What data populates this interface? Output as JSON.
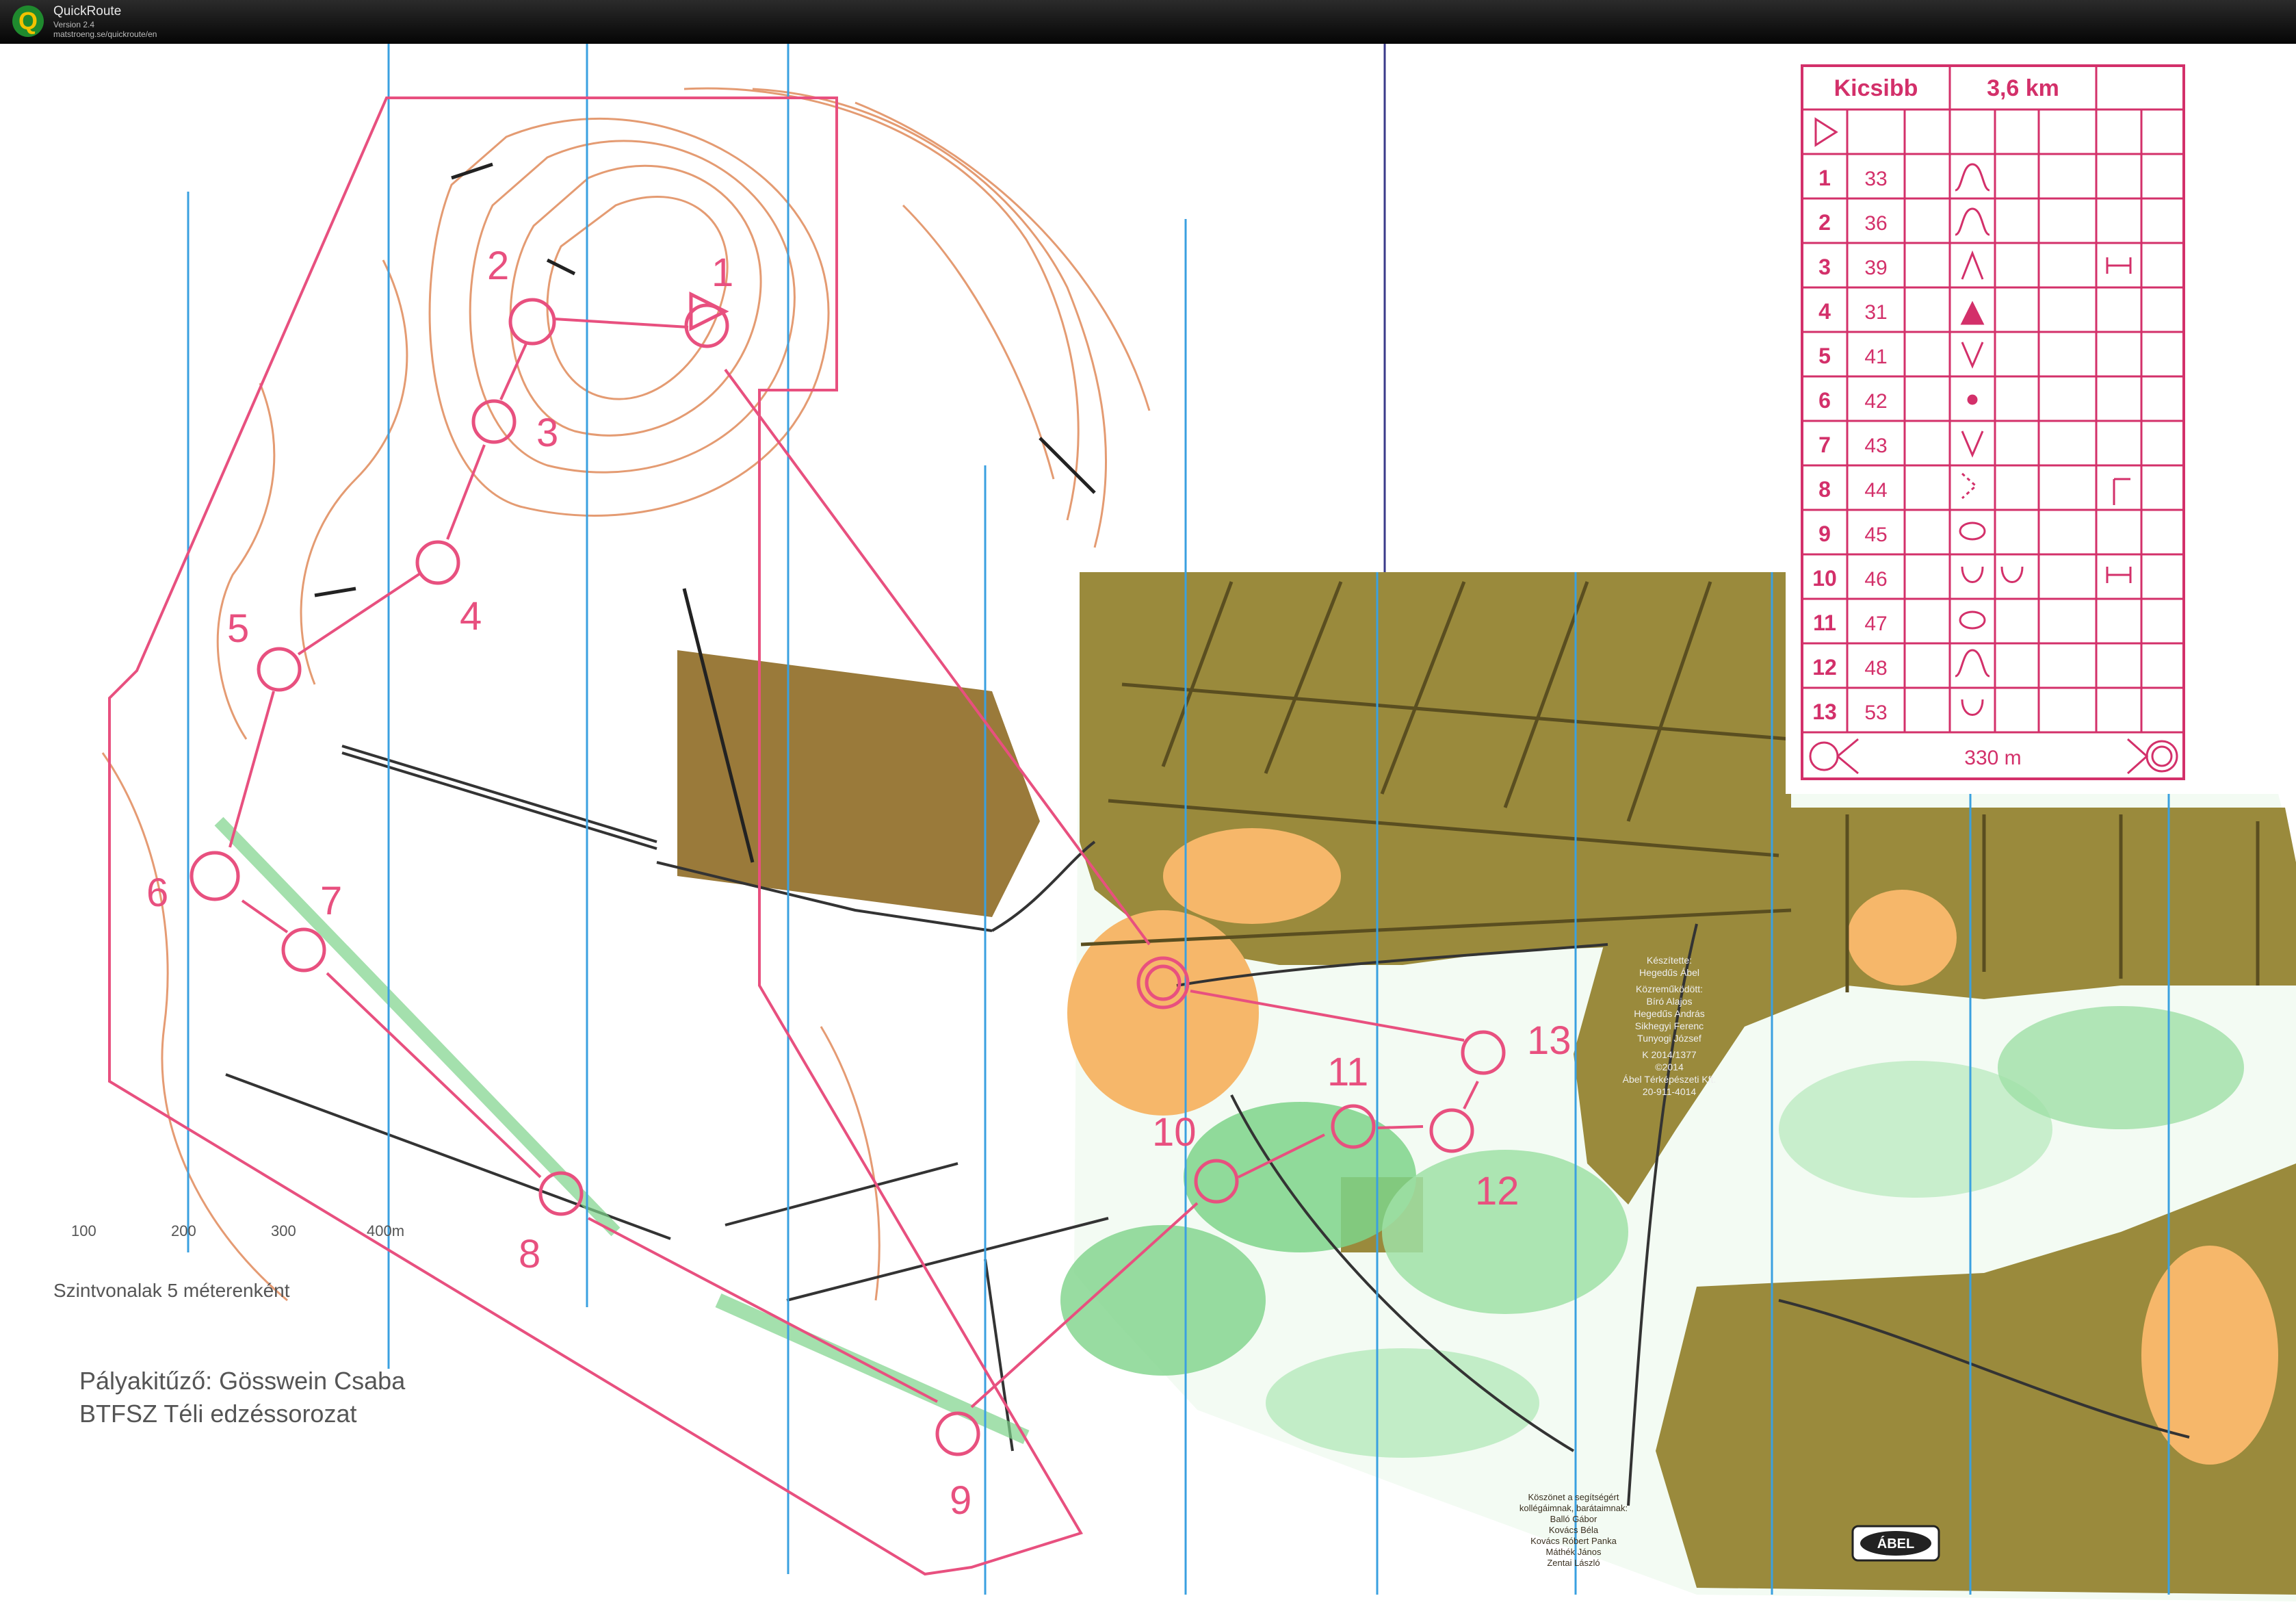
{
  "app": {
    "name": "QuickRoute",
    "version": "Version 2.4",
    "url": "matstroeng.se/quickroute/en",
    "logo_letter": "Q"
  },
  "map": {
    "scale_ticks": [
      "100",
      "200",
      "300",
      "400m"
    ],
    "contour_note": "Szintvonalak 5 méterenként",
    "course_setter": "Pályakitűző: Gösswein Csaba",
    "series_name": "BTFSZ Téli edzéssorozat",
    "credits_top": [
      "Készítette:",
      "Hegedűs Ábel",
      "Közreműködött:",
      "Bíró Alajos",
      "Hegedűs András",
      "Sikhegyi Ferenc",
      "Tunyogi József",
      "K 2014/1377",
      "©2014",
      "Ábel Térképészeti Kft.",
      "20-911-4014"
    ],
    "credits_bottom": [
      "Köszönet a segítségért",
      "kollégáimnak, barátaimnak:",
      "Balló Gábor",
      "Kovács Béla",
      "Kovács Róbert Panka",
      "Máthék János",
      "Zentai László"
    ],
    "logo_text": "ÁBEL",
    "control_numbers": [
      "1",
      "2",
      "3",
      "4",
      "5",
      "6",
      "7",
      "8",
      "9",
      "10",
      "11",
      "12",
      "13"
    ]
  },
  "descriptions": {
    "course": "Kicsibb",
    "length": "3,6 km",
    "finish_distance": "330 m",
    "rows": [
      {
        "num": "1",
        "code": "33"
      },
      {
        "num": "2",
        "code": "36"
      },
      {
        "num": "3",
        "code": "39"
      },
      {
        "num": "4",
        "code": "31"
      },
      {
        "num": "5",
        "code": "41"
      },
      {
        "num": "6",
        "code": "42"
      },
      {
        "num": "7",
        "code": "43"
      },
      {
        "num": "8",
        "code": "44"
      },
      {
        "num": "9",
        "code": "45"
      },
      {
        "num": "10",
        "code": "46"
      },
      {
        "num": "11",
        "code": "47"
      },
      {
        "num": "12",
        "code": "48"
      },
      {
        "num": "13",
        "code": "53"
      }
    ]
  },
  "colors": {
    "course": "#e8507f",
    "forest_olive": "#9a8a3c",
    "open_orange": "#f6b76a",
    "green": "#7ed38a",
    "north_lines": "#3aa0e0",
    "contours": "#e08a5a"
  }
}
